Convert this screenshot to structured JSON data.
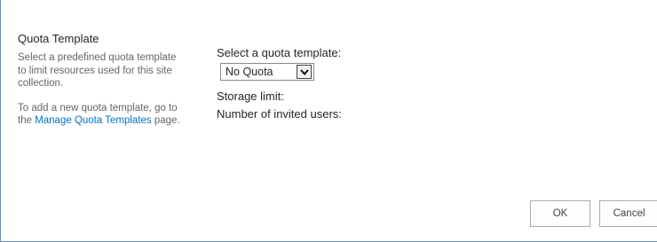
{
  "quota": {
    "title": "Quota Template",
    "description": "Select a predefined quota template to limit resources used for this site collection.",
    "add_text_before": "To add a new quota template, go to the ",
    "manage_link": "Manage Quota Templates",
    "add_text_after": " page.",
    "select_label": "Select a quota template:",
    "selected_value": "No Quota",
    "storage_label": "Storage limit:",
    "invited_label": "Number of invited users:"
  },
  "buttons": {
    "ok": "OK",
    "cancel": "Cancel"
  }
}
